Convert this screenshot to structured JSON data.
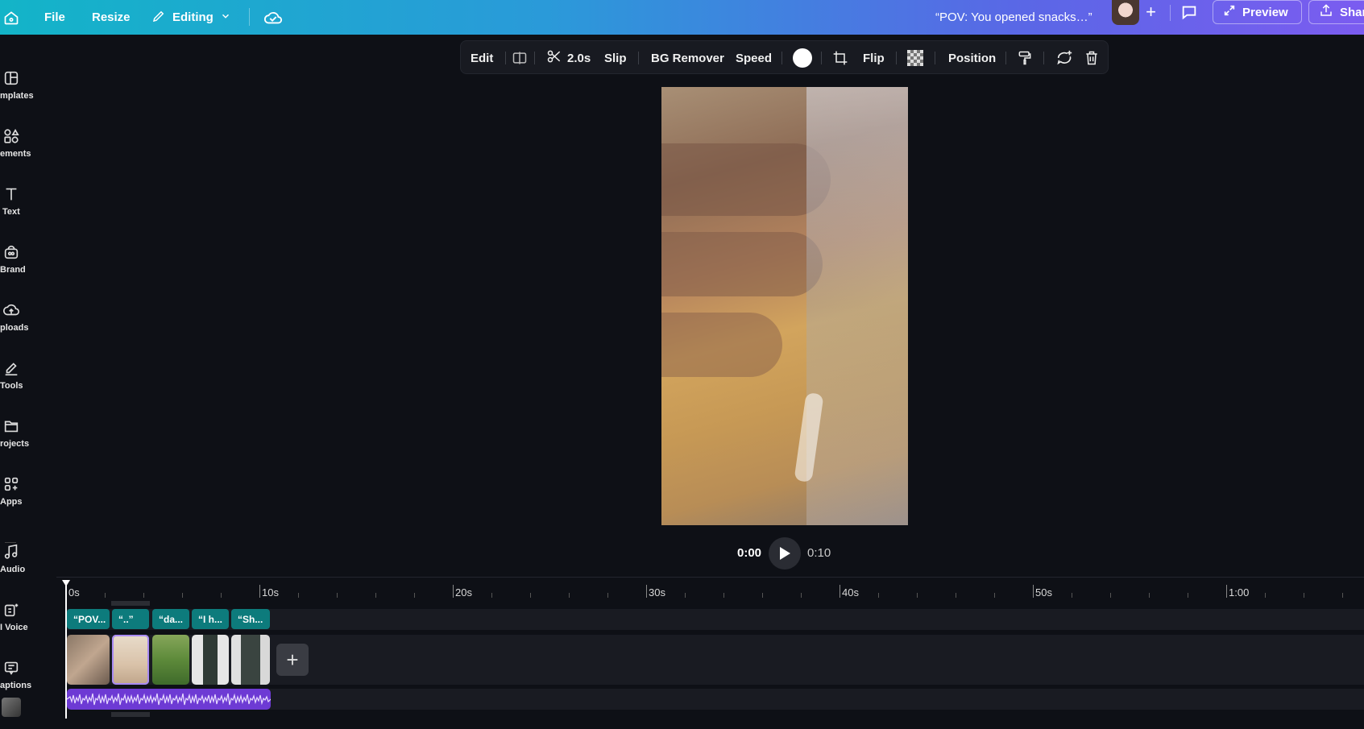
{
  "topbar": {
    "file": "File",
    "resize": "Resize",
    "editing": "Editing",
    "title": "“POV: You opened snacks…”",
    "preview": "Preview",
    "share": "Shar"
  },
  "sidebar": {
    "items": [
      {
        "label": "mplates",
        "icon": "templates-icon"
      },
      {
        "label": "ements",
        "icon": "elements-icon"
      },
      {
        "label": "Text",
        "icon": "text-icon"
      },
      {
        "label": "Brand",
        "icon": "brand-icon"
      },
      {
        "label": "ploads",
        "icon": "uploads-icon"
      },
      {
        "label": "Tools",
        "icon": "tools-icon"
      },
      {
        "label": "rojects",
        "icon": "projects-icon"
      },
      {
        "label": "Apps",
        "icon": "apps-icon"
      },
      {
        "label": "Audio",
        "icon": "audio-icon"
      },
      {
        "label": "I Voice",
        "icon": "ai-voice-icon"
      },
      {
        "label": "aptions",
        "icon": "captions-icon"
      }
    ]
  },
  "context_toolbar": {
    "edit": "Edit",
    "duration": "2.0s",
    "slip": "Slip",
    "bg_remover": "BG Remover",
    "speed": "Speed",
    "flip": "Flip",
    "position": "Position"
  },
  "playback": {
    "current_time": "0:00",
    "total_time": "0:10"
  },
  "timeline": {
    "ruler": [
      "0s",
      "10s",
      "20s",
      "30s",
      "40s",
      "50s",
      "1:00"
    ],
    "captions": [
      "“POV...",
      "“..”",
      "“da...",
      "“I h...",
      "“Sh..."
    ]
  },
  "colors": {
    "accent_purple": "#7b5cf0",
    "accent_teal": "#13b4c8",
    "caption_chip": "#0d7b7c",
    "audio_track": "#6d3ad4"
  }
}
